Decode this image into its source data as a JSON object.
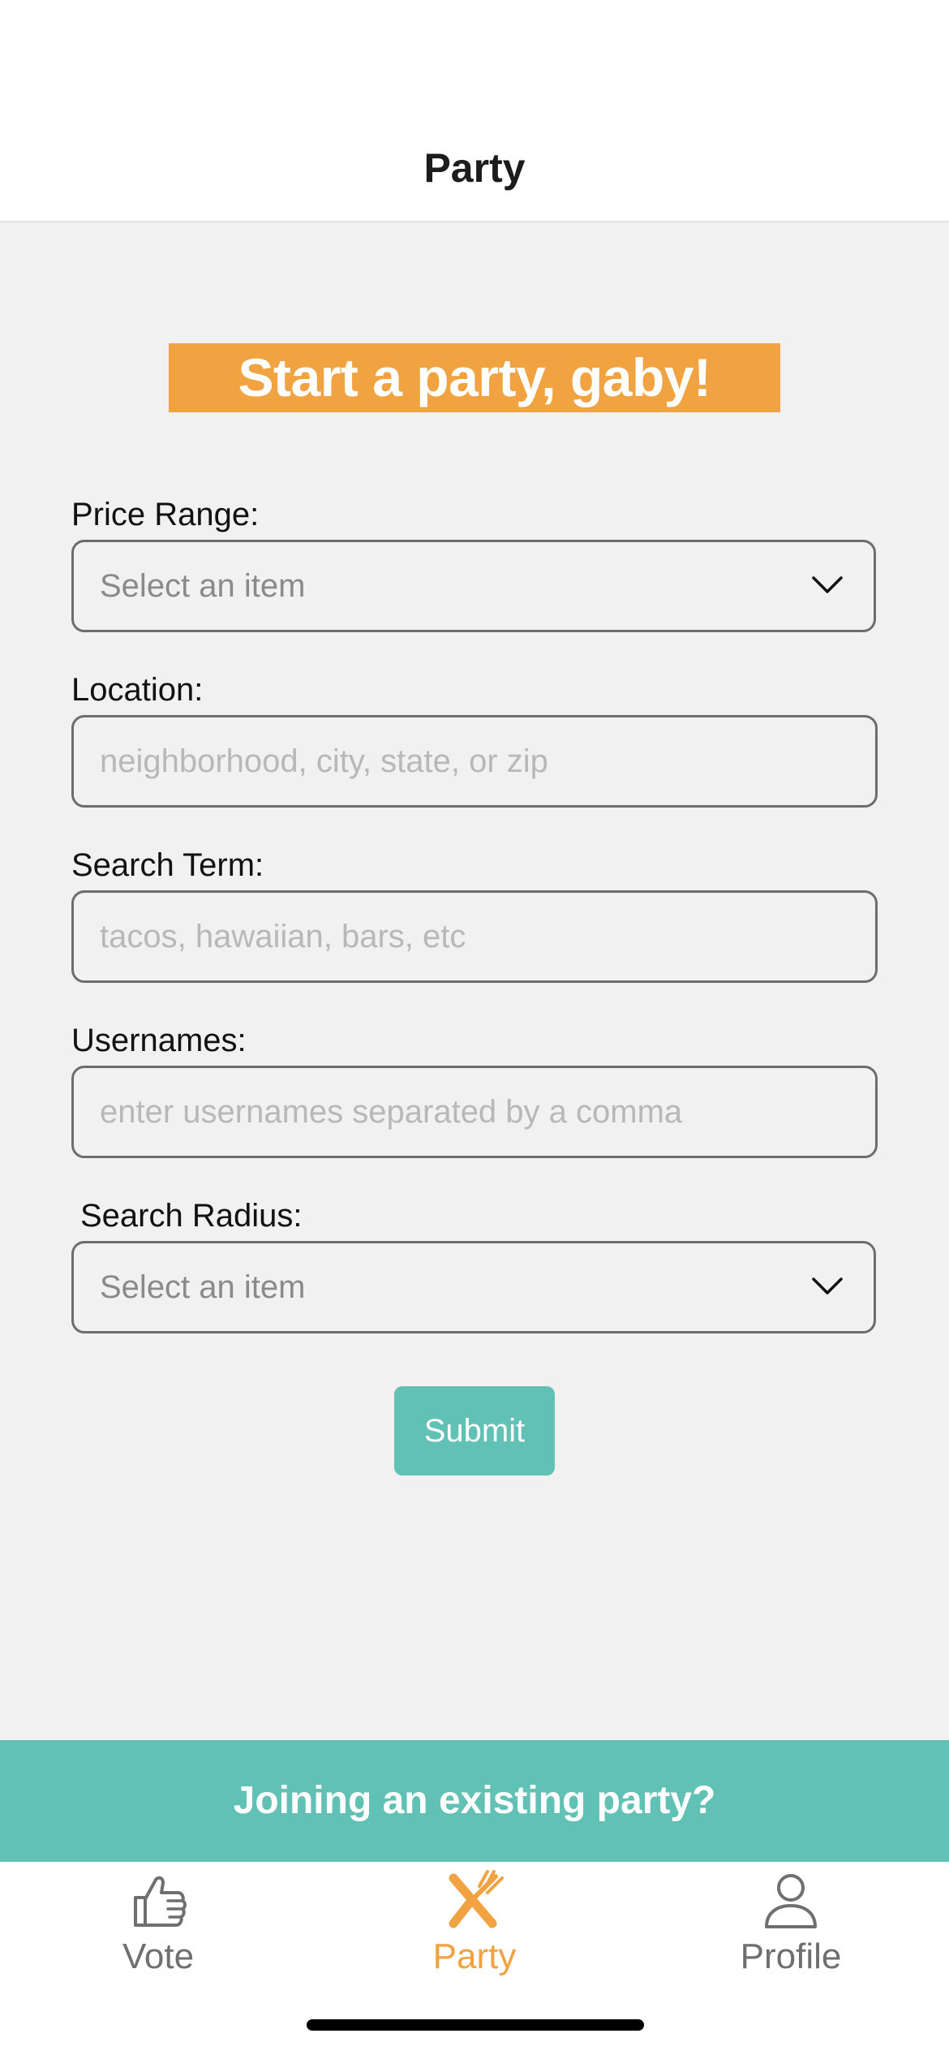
{
  "header": {
    "title": "Party"
  },
  "banner": {
    "text": "Start a party, gaby!"
  },
  "form": {
    "price_range": {
      "label": "Price Range:",
      "value": "Select an item"
    },
    "location": {
      "label": "Location:",
      "placeholder": "neighborhood, city, state, or zip"
    },
    "search_term": {
      "label": "Search Term:",
      "placeholder": "tacos, hawaiian, bars, etc"
    },
    "usernames": {
      "label": "Usernames:",
      "placeholder": "enter usernames separated by a comma"
    },
    "search_radius": {
      "label": "Search Radius:",
      "value": "Select an item"
    },
    "submit_label": "Submit"
  },
  "join_bar": {
    "text": "Joining an existing party?"
  },
  "tabs": [
    {
      "label": "Vote",
      "icon": "thumbs-up-icon",
      "active": false
    },
    {
      "label": "Party",
      "icon": "utensils-icon",
      "active": true
    },
    {
      "label": "Profile",
      "icon": "user-icon",
      "active": false
    }
  ],
  "colors": {
    "accent_orange": "#f0a340",
    "accent_teal": "#60c1b4",
    "background": "#f1f1f1"
  }
}
